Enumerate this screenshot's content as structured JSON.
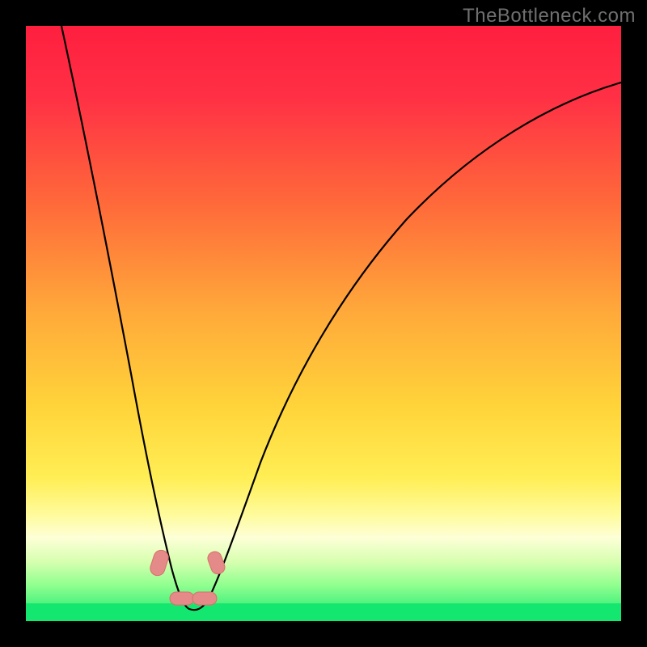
{
  "watermark": "TheBottleneck.com",
  "chart_data": {
    "type": "line",
    "title": "",
    "xlabel": "",
    "ylabel": "",
    "xlim": [
      0,
      100
    ],
    "ylim": [
      0,
      100
    ],
    "axes_visible": false,
    "grid": false,
    "background_gradient": {
      "orientation": "vertical",
      "stops": [
        {
          "pct": 0,
          "color": "#ff1f3f"
        },
        {
          "pct": 12,
          "color": "#ff3045"
        },
        {
          "pct": 30,
          "color": "#ff6a3a"
        },
        {
          "pct": 48,
          "color": "#ffa93a"
        },
        {
          "pct": 64,
          "color": "#ffd43a"
        },
        {
          "pct": 76,
          "color": "#ffee55"
        },
        {
          "pct": 82,
          "color": "#fffb9a"
        },
        {
          "pct": 86,
          "color": "#fdffd7"
        },
        {
          "pct": 90,
          "color": "#d7ffb0"
        },
        {
          "pct": 94,
          "color": "#8fff8f"
        },
        {
          "pct": 100,
          "color": "#14e76f"
        }
      ]
    },
    "curve": {
      "description": "V-shaped bottleneck curve descending from top-left, bottoming near x≈27, rising to upper right",
      "points_xy": [
        [
          6,
          100
        ],
        [
          10,
          80
        ],
        [
          14,
          60
        ],
        [
          18,
          40
        ],
        [
          22,
          18
        ],
        [
          25,
          6
        ],
        [
          27,
          2
        ],
        [
          29,
          2
        ],
        [
          31,
          6
        ],
        [
          35,
          18
        ],
        [
          42,
          36
        ],
        [
          52,
          54
        ],
        [
          64,
          68
        ],
        [
          78,
          78
        ],
        [
          92,
          84
        ],
        [
          100,
          87
        ]
      ]
    },
    "markers": {
      "color": "#e57373",
      "shape": "rounded-pill",
      "positions_xy": [
        [
          22.5,
          9
        ],
        [
          25.5,
          2.2
        ],
        [
          28.5,
          2.2
        ],
        [
          31.0,
          8
        ]
      ]
    },
    "baseline_band": {
      "y_range": [
        0,
        3
      ],
      "color": "#14e76f"
    }
  }
}
